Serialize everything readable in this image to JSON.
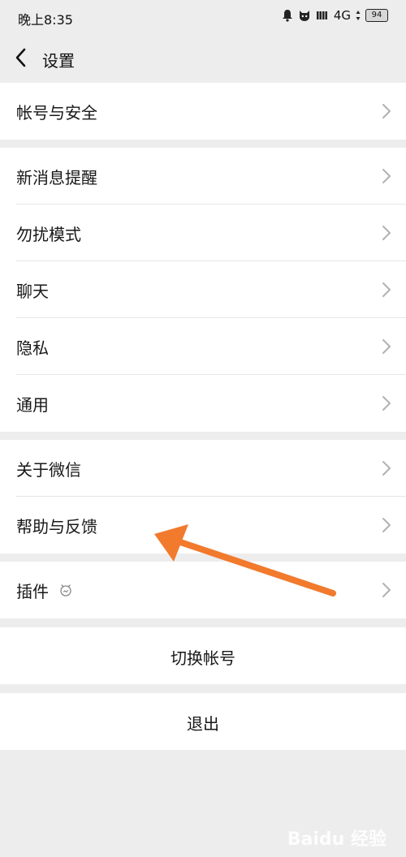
{
  "status_bar": {
    "time": "晚上8:35",
    "network": "4G",
    "battery": "94",
    "icons": [
      "notification-bell-icon",
      "cat-icon",
      "signal-bars-icon"
    ]
  },
  "header": {
    "title": "设置",
    "back_icon": "chevron-left-icon"
  },
  "groups": [
    {
      "items": [
        {
          "label": "帐号与安全"
        }
      ]
    },
    {
      "items": [
        {
          "label": "新消息提醒"
        },
        {
          "label": "勿扰模式"
        },
        {
          "label": "聊天"
        },
        {
          "label": "隐私"
        },
        {
          "label": "通用"
        }
      ]
    },
    {
      "items": [
        {
          "label": "关于微信"
        },
        {
          "label": "帮助与反馈"
        }
      ]
    },
    {
      "items": [
        {
          "label": "插件",
          "badge_icon": "plugin-face-icon"
        }
      ]
    }
  ],
  "actions": {
    "switch_account": "切换帐号",
    "logout": "退出"
  },
  "annotation": {
    "arrow_color": "#f27a2d",
    "points_to": "帮助与反馈"
  },
  "watermark": "Baidu 经验",
  "colors": {
    "background": "#ededed",
    "cell": "#ffffff",
    "separator": "#e6e6e6",
    "arrow": "#f27a2d"
  }
}
